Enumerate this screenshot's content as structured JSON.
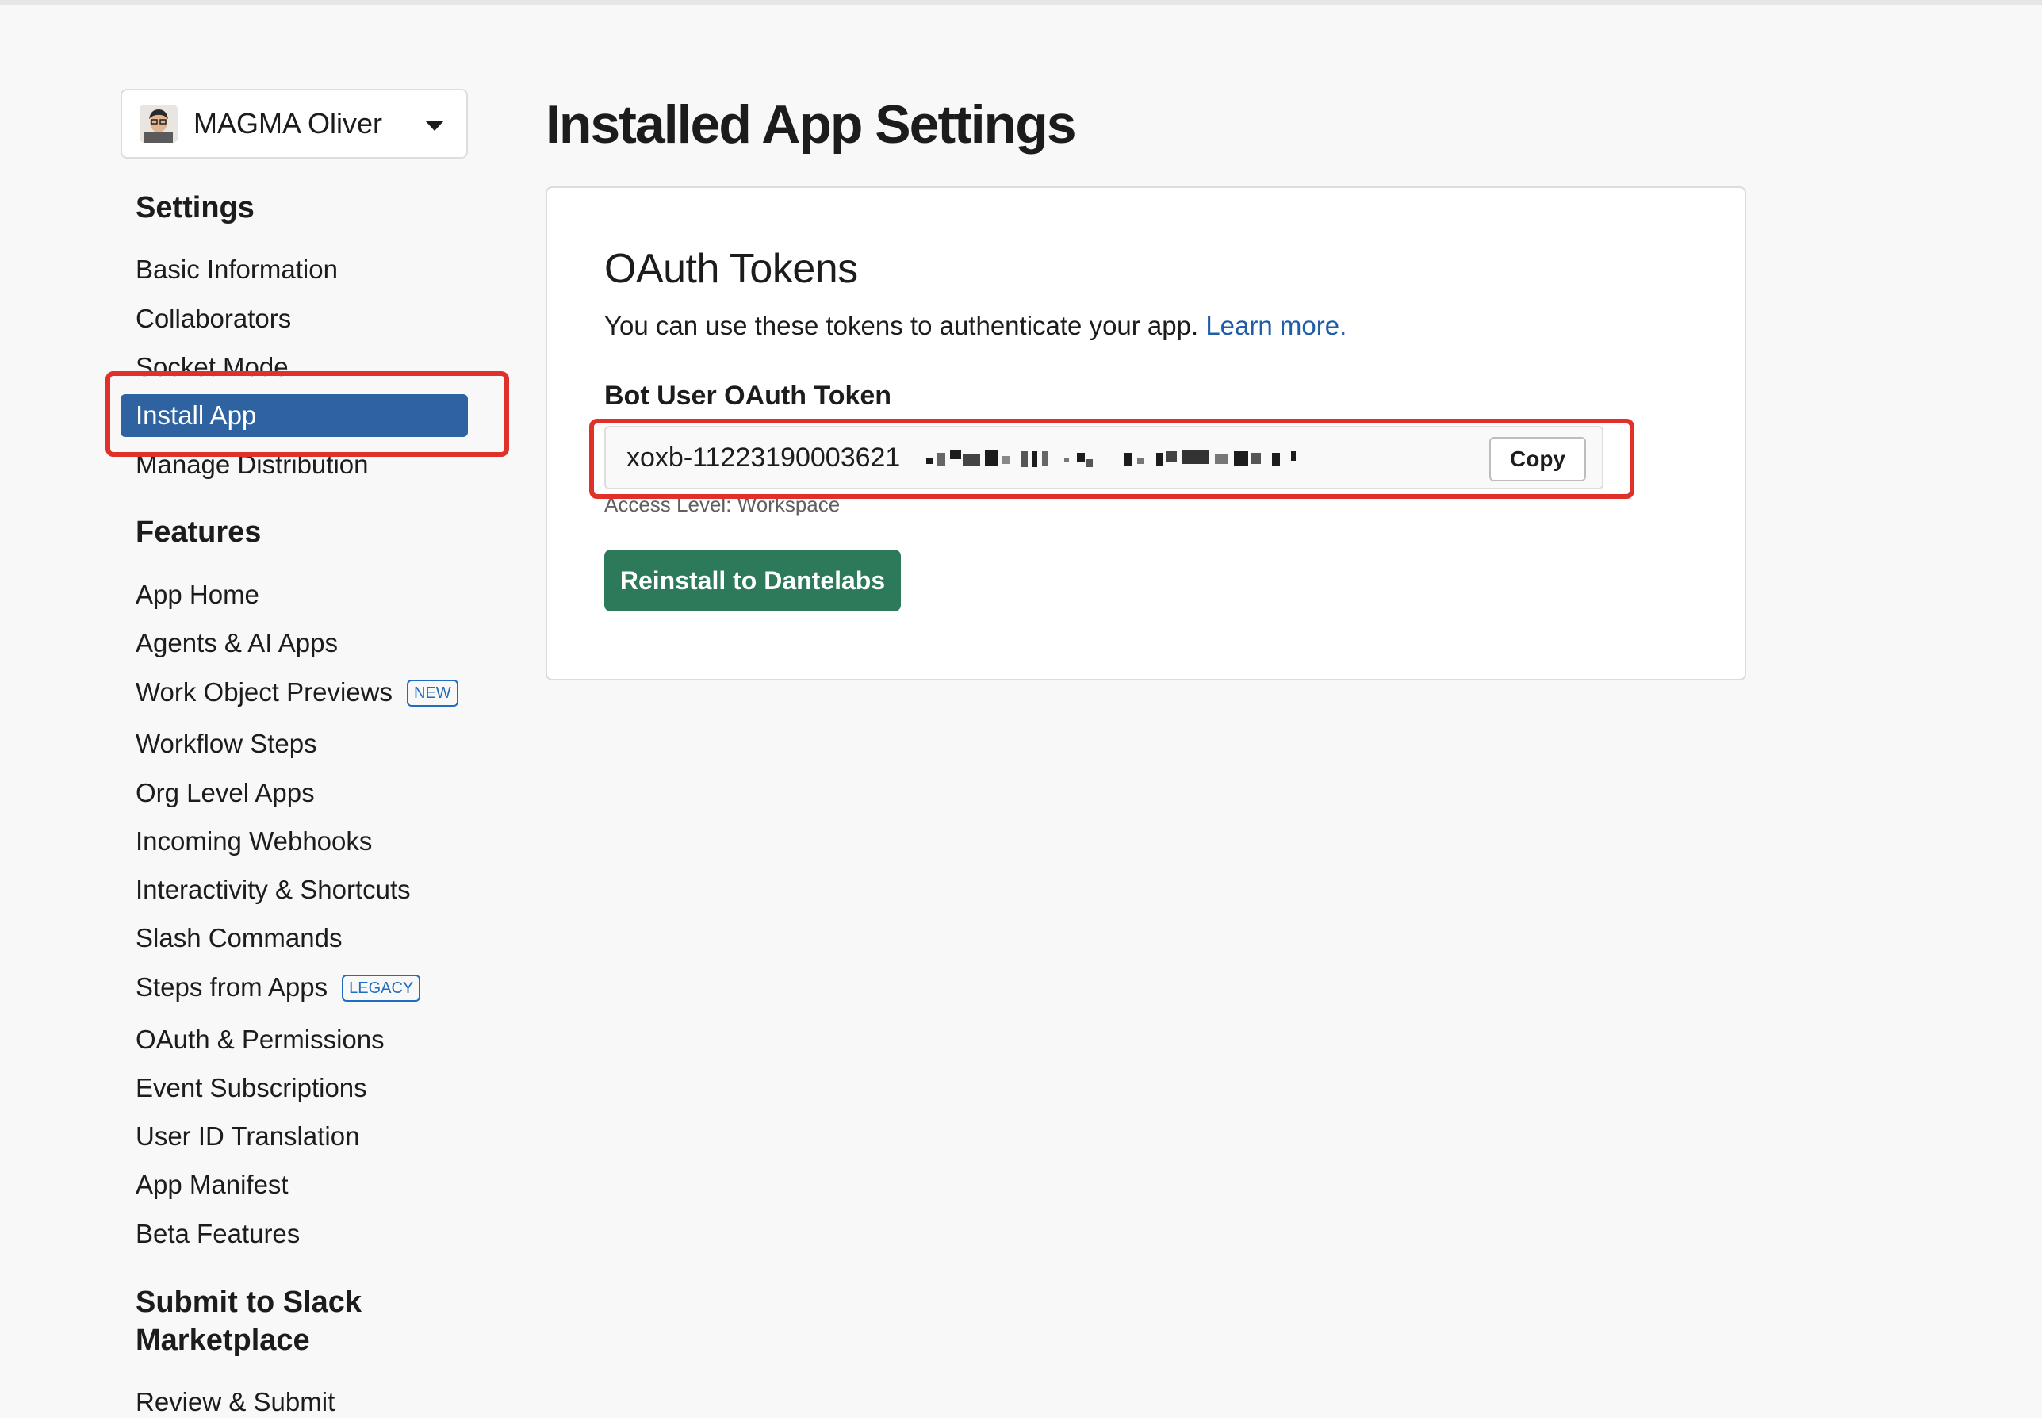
{
  "workspace": {
    "name": "MAGMA Oliver"
  },
  "sidebar": {
    "settings_heading": "Settings",
    "settings_items": [
      {
        "label": "Basic Information"
      },
      {
        "label": "Collaborators"
      },
      {
        "label": "Socket Mode"
      },
      {
        "label": "Install App",
        "active": true
      },
      {
        "label": "Manage Distribution"
      }
    ],
    "features_heading": "Features",
    "features_items": [
      {
        "label": "App Home"
      },
      {
        "label": "Agents & AI Apps"
      },
      {
        "label": "Work Object Previews",
        "badge": "NEW"
      },
      {
        "label": "Workflow Steps"
      },
      {
        "label": "Org Level Apps"
      },
      {
        "label": "Incoming Webhooks"
      },
      {
        "label": "Interactivity & Shortcuts"
      },
      {
        "label": "Slash Commands"
      },
      {
        "label": "Steps from Apps",
        "badge": "LEGACY"
      },
      {
        "label": "OAuth & Permissions"
      },
      {
        "label": "Event Subscriptions"
      },
      {
        "label": "User ID Translation"
      },
      {
        "label": "App Manifest"
      },
      {
        "label": "Beta Features"
      }
    ],
    "submit_heading": "Submit to Slack Marketplace",
    "submit_items": [
      {
        "label": "Review & Submit"
      }
    ]
  },
  "main": {
    "title": "Installed App Settings",
    "oauth": {
      "title": "OAuth Tokens",
      "description": "You can use these tokens to authenticate your app.",
      "learn_more": "Learn more.",
      "token_label": "Bot User OAuth Token",
      "token_value": "xoxb-11223190003621",
      "copy_label": "Copy",
      "access_level": "Access Level: Workspace",
      "reinstall_label": "Reinstall to Dantelabs"
    }
  },
  "colors": {
    "active_nav": "#2e62a0",
    "highlight": "#e0302a",
    "reinstall_button": "#2c7a5a",
    "link": "#1f5da8"
  }
}
